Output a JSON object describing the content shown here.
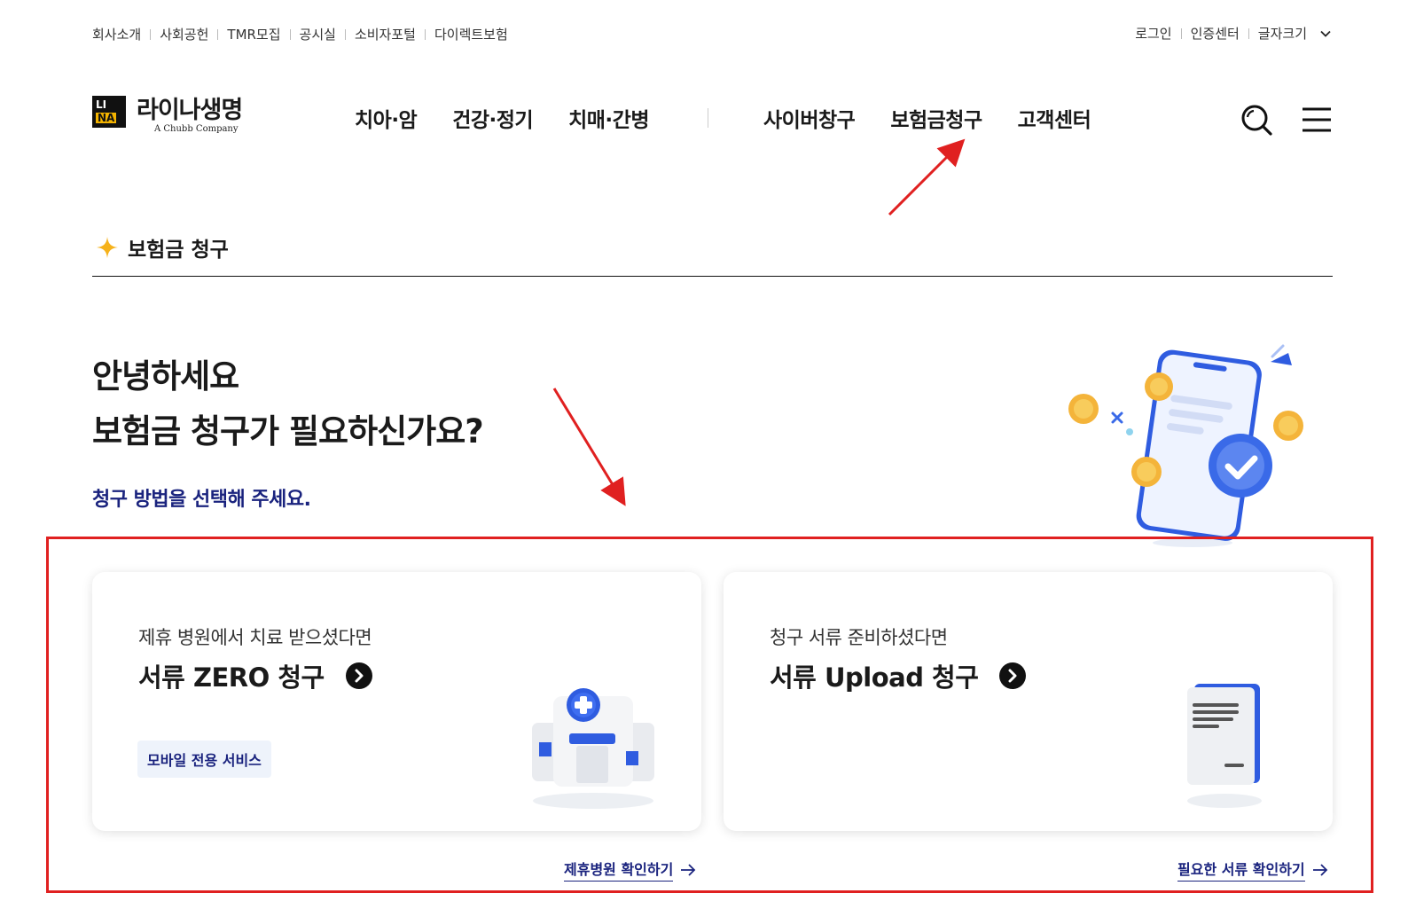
{
  "util_nav": {
    "items": [
      "회사소개",
      "사회공헌",
      "TMR모집",
      "공시실",
      "소비자포털",
      "다이렉트보험"
    ]
  },
  "util_right": {
    "login": "로그인",
    "cert": "인증센터",
    "font_size": "글자크기"
  },
  "logo": {
    "mark_top": "LI",
    "mark_bottom": "NA",
    "name": "라이나생명",
    "sub": "A Chubb Company"
  },
  "gnb": {
    "product_items": [
      "치아·암",
      "건강·정기",
      "치매·간병"
    ],
    "service_items": [
      "사이버창구",
      "보험금청구",
      "고객센터"
    ]
  },
  "section": {
    "title": "보험금 청구"
  },
  "hero": {
    "line1": "안녕하세요",
    "line2": "보험금 청구가 필요하신가요?",
    "sub": "청구 방법을 선택해 주세요."
  },
  "cards": [
    {
      "lead": "제휴 병원에서 치료 받으셨다면",
      "title": "서류 ZERO 청구",
      "badge": "모바일 전용 서비스",
      "link": "제휴병원 확인하기",
      "icon": "hospital-icon"
    },
    {
      "lead": "청구 서류 준비하셨다면",
      "title": "서류 Upload 청구",
      "link": "필요한 서류 확인하기",
      "icon": "document-icon"
    }
  ],
  "colors": {
    "accent_navy": "#1a237e",
    "star_yellow": "#f6b21b",
    "annotation_red": "#e02020",
    "illustration_blue": "#2f5ce0"
  }
}
